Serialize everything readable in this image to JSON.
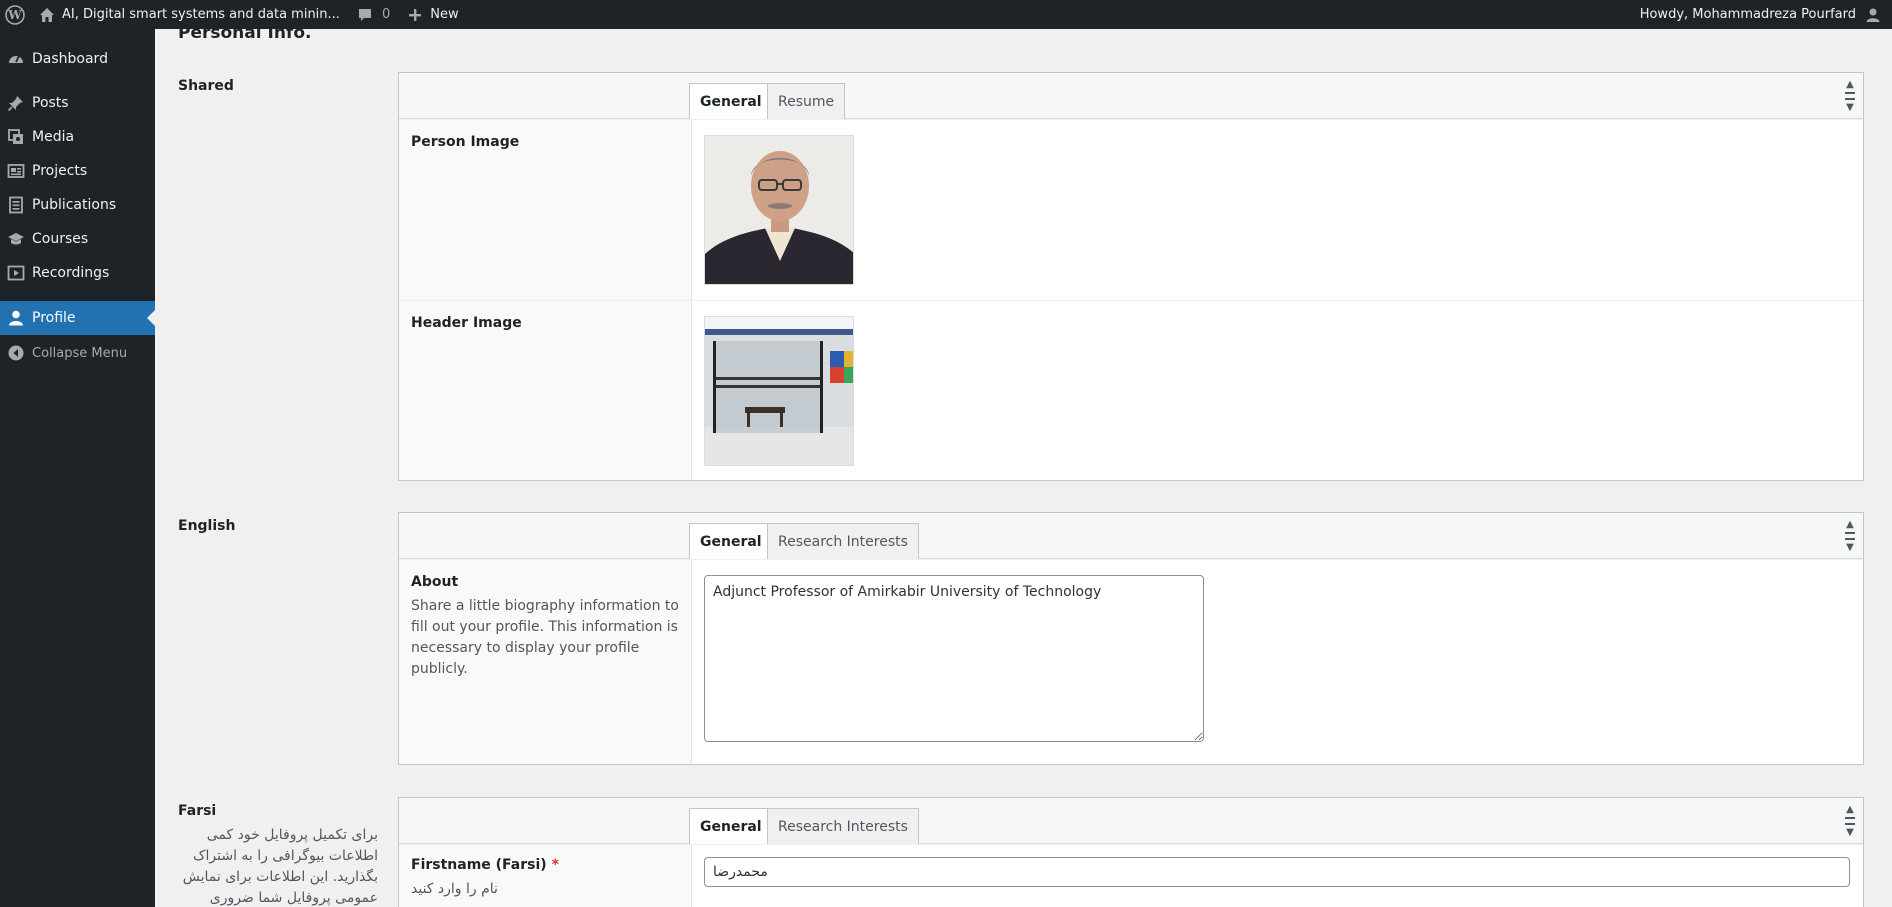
{
  "adminbar": {
    "site_title": "AI, Digital smart systems and data minin...",
    "comments_count": "0",
    "new_label": "New",
    "greeting": "Howdy, Mohammadreza Pourfard"
  },
  "sidebar": {
    "items": [
      {
        "label": "Dashboard",
        "icon": "dashboard-icon"
      },
      {
        "label": "Posts",
        "icon": "pin-icon"
      },
      {
        "label": "Media",
        "icon": "media-icon"
      },
      {
        "label": "Projects",
        "icon": "portfolio-icon"
      },
      {
        "label": "Publications",
        "icon": "document-icon"
      },
      {
        "label": "Courses",
        "icon": "graduation-cap-icon"
      },
      {
        "label": "Recordings",
        "icon": "video-icon"
      },
      {
        "label": "Profile",
        "icon": "user-icon"
      },
      {
        "label": "Collapse Menu",
        "icon": "collapse-icon"
      }
    ]
  },
  "main": {
    "heading": "Personal Info.",
    "shared": {
      "label": "Shared",
      "tabs": [
        "General",
        "Resume"
      ],
      "person_image_label": "Person Image",
      "header_image_label": "Header Image"
    },
    "english": {
      "label": "English",
      "tabs": [
        "General",
        "Research Interests"
      ],
      "about_label": "About",
      "about_desc": "Share a little biography information to fill out your profile. This information is necessary to display your profile publicly.",
      "about_value": "Adjunct Professor of Amirkabir University of Technology"
    },
    "farsi": {
      "label": "Farsi",
      "desc": "برای تکمیل پروفایل خود کمی اطلاعات بیوگرافی را به اشتراک بگذارید. این اطلاعات برای نمایش عمومی پروفایل شما ضروری است.",
      "tabs": [
        "General",
        "Research Interests"
      ],
      "firstname_label": "Firstname (Farsi)",
      "required_mark": "*",
      "firstname_desc": "نام را وارد کنید",
      "firstname_value": "محمدرضا"
    }
  },
  "colors": {
    "admin_bar": "#1d2327",
    "accent": "#2271b1",
    "background": "#f0f0f1"
  }
}
